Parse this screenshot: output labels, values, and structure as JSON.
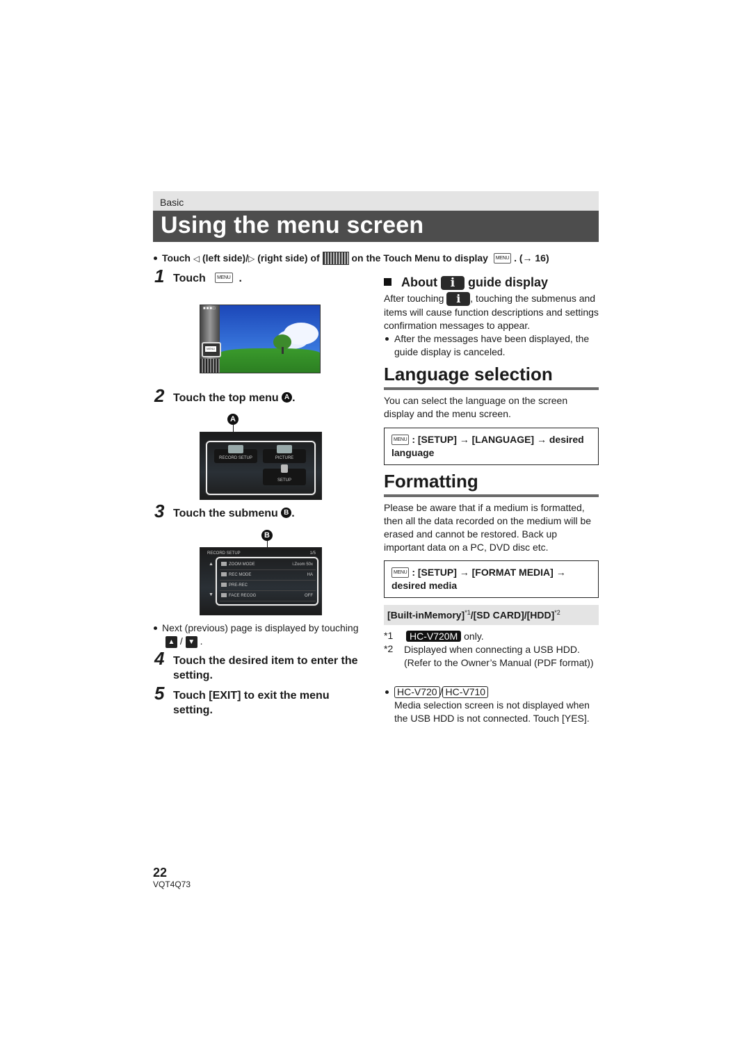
{
  "section_label": "Basic",
  "page_title": "Using the menu screen",
  "intro": {
    "touch": "Touch",
    "left_side": "(left side)/",
    "right_side": "(right side) of",
    "on_touch_menu": "on the Touch Menu to display",
    "ref": ". (→ 16)"
  },
  "icons": {
    "menu_label": "MENU",
    "left_triangle": "◁",
    "right_triangle": "▷",
    "up_arrow": "▲",
    "down_arrow": "▼",
    "info": "i",
    "square": "■"
  },
  "steps": [
    {
      "num": "1",
      "text": "Touch",
      "suffix": "."
    },
    {
      "num": "2",
      "text": "Touch the top menu",
      "callout": "A",
      "suffix": "."
    },
    {
      "num": "3",
      "text": "Touch the submenu",
      "callout": "B",
      "suffix": "."
    },
    {
      "num": "4",
      "text": "Touch the desired item to enter the setting."
    },
    {
      "num": "5",
      "text": "Touch [EXIT] to exit the menu setting."
    }
  ],
  "screen2": {
    "callout": "A",
    "tiles": [
      "RECORD SETUP",
      "PICTURE",
      "SETUP"
    ]
  },
  "screen3": {
    "callout": "B",
    "header": "RECORD SETUP",
    "page": "1/5",
    "rows": [
      {
        "label": "ZOOM MODE",
        "value": "i.Zoom 50x"
      },
      {
        "label": "REC MODE",
        "value": "HA"
      },
      {
        "label": "PRE-REC",
        "value": ""
      },
      {
        "label": "FACE RECOG",
        "value": "OFF"
      }
    ]
  },
  "page_note": {
    "text": "Next (previous) page is displayed by touching",
    "sep": "/",
    "end": "."
  },
  "about": {
    "heading_pre": "About",
    "heading_post": "guide display",
    "body_pre": "After touching",
    "body_post": ", touching the submenus and items will cause function descriptions and settings confirmation messages to appear.",
    "bullet": "After the messages have been displayed, the guide display is canceled."
  },
  "language": {
    "heading": "Language selection",
    "body": "You can select the language on the screen display and the menu screen.",
    "path": ": [SETUP] → [LANGUAGE] → desired language"
  },
  "formatting": {
    "heading": "Formatting",
    "body": "Please be aware that if a medium is formatted, then all the data recorded on the medium will be erased and cannot be restored. Back up important data on a PC, DVD disc etc.",
    "path": ": [SETUP] → [FORMAT MEDIA] → desired media",
    "media_options": "[Built-inMemory]",
    "sup1": "*1",
    "media_rest": "/[SD CARD]/[HDD]",
    "sup2": "*2",
    "footnotes": [
      {
        "mark": "*1",
        "model": "HC-V720M",
        "text": "only."
      },
      {
        "mark": "*2",
        "text": "Displayed when connecting a USB HDD. (Refer to the Owner’s Manual (PDF format))"
      }
    ],
    "models_note": {
      "models": [
        "HC-V720",
        "HC-V710"
      ],
      "sep": "/",
      "text": "Media selection screen is not displayed when the USB HDD is not connected. Touch [YES]."
    }
  },
  "footer": {
    "page_number": "22",
    "doc_code": "VQT4Q73"
  }
}
